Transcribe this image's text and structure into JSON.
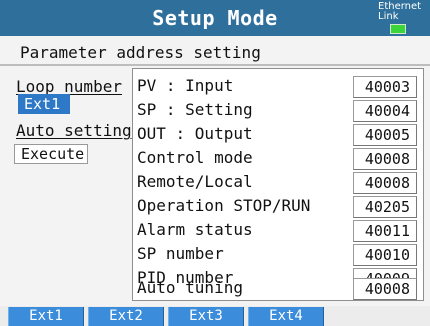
{
  "header": {
    "title": "Setup Mode",
    "status_top": "Ethernet",
    "status_bottom": "Link"
  },
  "subtitle": "Parameter address setting",
  "left": {
    "loop_label": "Loop number",
    "loop_value": "Ext1",
    "auto_label": "Auto setting",
    "auto_value": "Execute"
  },
  "params": [
    {
      "label": "PV : Input",
      "value": "40003"
    },
    {
      "label": "SP : Setting",
      "value": "40004"
    },
    {
      "label": "OUT : Output",
      "value": "40005"
    },
    {
      "label": "Control mode",
      "value": "40008"
    },
    {
      "label": "Remote/Local",
      "value": "40008"
    },
    {
      "label": "Operation STOP/RUN",
      "value": "40205"
    },
    {
      "label": "Alarm status",
      "value": "40011"
    },
    {
      "label": "SP number",
      "value": "40010"
    },
    {
      "label": "PID number",
      "value": "40009"
    },
    {
      "label": "Auto tuning",
      "value": "40008"
    }
  ],
  "softkeys": [
    "Ext1",
    "Ext2",
    "Ext3",
    "Ext4"
  ],
  "colors": {
    "header": "#2f6f9c",
    "selected": "#2d78c7",
    "softkey": "#3b8ddb",
    "link_led": "#3bd43b"
  }
}
